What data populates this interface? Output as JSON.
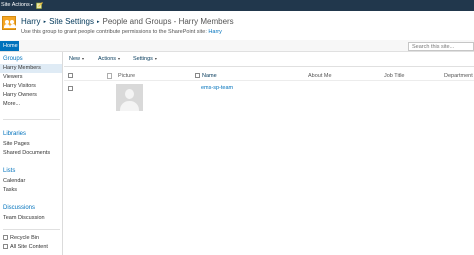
{
  "topbar": {
    "site_actions": "Site Actions",
    "site_actions_arrow": "▾"
  },
  "breadcrumb": {
    "site": "Harry",
    "settings": "Site Settings",
    "current": "People and Groups - Harry Members",
    "separator": "▸"
  },
  "description": {
    "text": "Use this group to grant people contribute permissions to the SharePoint site: ",
    "link": "Harry"
  },
  "nav": {
    "home_tab": "Home",
    "search_placeholder": "Search this site..."
  },
  "sidebar": {
    "groups_heading": "Groups",
    "groups": [
      "Harry Members",
      "Viewers",
      "Harry Visitors",
      "Harry Owners",
      "More..."
    ],
    "libraries_heading": "Libraries",
    "libraries": [
      "Site Pages",
      "Shared Documents"
    ],
    "lists_heading": "Lists",
    "lists": [
      "Calendar",
      "Tasks"
    ],
    "discussions_heading": "Discussions",
    "discussions": [
      "Team Discussion"
    ],
    "recycle_bin": "Recycle Bin",
    "all_site_content": "All Site Content"
  },
  "toolbar": {
    "new": "New",
    "actions": "Actions",
    "settings": "Settings",
    "arrow": "▾"
  },
  "table": {
    "columns": {
      "picture": "Picture",
      "name": "Name",
      "about_me": "About Me",
      "job_title": "Job Title",
      "department": "Department"
    },
    "rows": [
      {
        "name": "ems-sp-team"
      }
    ]
  },
  "colors": {
    "topbar": "#21374c",
    "accent": "#0072bc",
    "selected": "#dfebf5",
    "site_icon": "#f6a623"
  },
  "icons": {
    "site": "people-group-icon",
    "edit": "edit-page-icon",
    "doc": "document-icon",
    "recycle": "recycle-bin-icon",
    "content": "site-content-icon"
  }
}
